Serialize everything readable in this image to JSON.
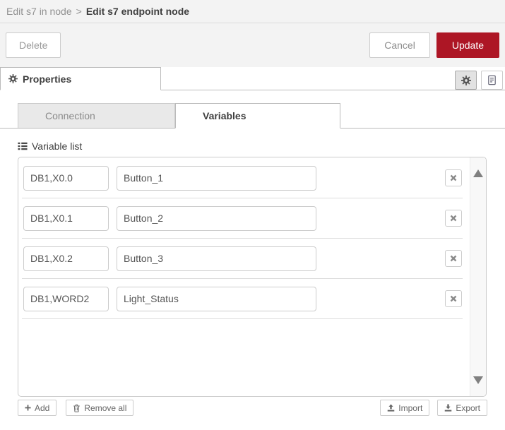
{
  "header": {
    "breadcrumb_parent": "Edit s7 in node",
    "breadcrumb_separator": ">",
    "breadcrumb_current": "Edit s7 endpoint node"
  },
  "toolbar": {
    "delete_label": "Delete",
    "cancel_label": "Cancel",
    "update_label": "Update"
  },
  "properties_tab": {
    "label": "Properties",
    "icon": "gear-icon"
  },
  "header_icon_buttons": [
    {
      "icon": "gear-icon",
      "state": "pressed"
    },
    {
      "icon": "document-icon",
      "state": "normal"
    }
  ],
  "subtabs": [
    {
      "label": "Connection",
      "active": false
    },
    {
      "label": "Variables",
      "active": true
    }
  ],
  "variable_list": {
    "title": "Variable list",
    "title_icon": "list-icon",
    "columns": [
      "address",
      "name"
    ],
    "rows": [
      {
        "address": "DB1,X0.0",
        "name": "Button_1"
      },
      {
        "address": "DB1,X0.1",
        "name": "Button_2"
      },
      {
        "address": "DB1,X0.2",
        "name": "Button_3"
      },
      {
        "address": "DB1,WORD2",
        "name": "Light_Status"
      }
    ],
    "row_remove_icon": "x-icon",
    "scrollbar": {
      "up_icon": "triangle-up-icon",
      "down_icon": "triangle-down-icon"
    }
  },
  "footer": {
    "add_label": "Add",
    "add_icon": "plus-icon",
    "remove_all_label": "Remove all",
    "remove_all_icon": "trash-icon",
    "import_label": "Import",
    "import_icon": "upload-icon",
    "export_label": "Export",
    "export_icon": "download-icon"
  },
  "colors": {
    "accent_red": "#ad1625",
    "header_bg": "#f3f3f3",
    "inactive_tab_bg": "#e9e9e9",
    "tab_border": "#bbbbbb",
    "input_border": "#cccccc"
  }
}
